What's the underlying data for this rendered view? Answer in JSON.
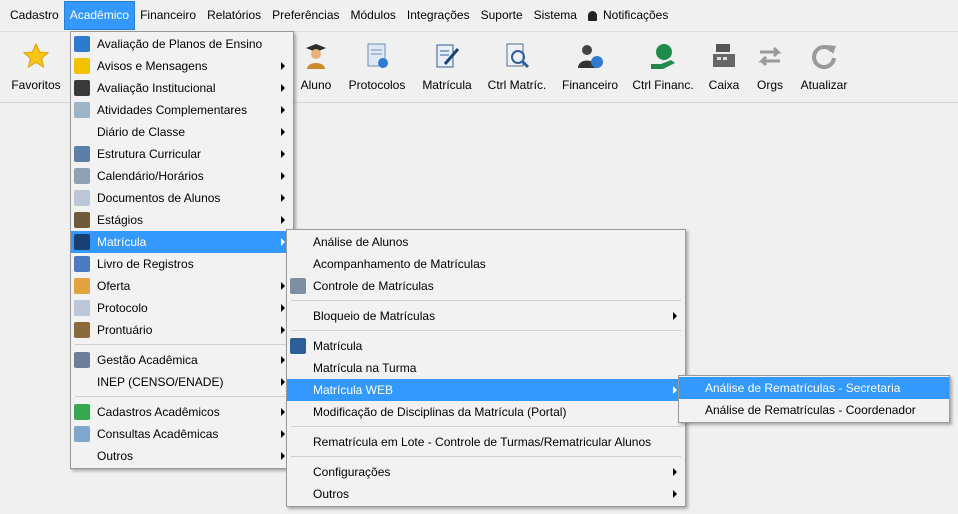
{
  "menubar": {
    "items": [
      "Cadastro",
      "Acadêmico",
      "Financeiro",
      "Relatórios",
      "Preferências",
      "Módulos",
      "Integrações",
      "Suporte",
      "Sistema"
    ],
    "notifications": "Notificações"
  },
  "toolbar": {
    "favoritos": "Favoritos",
    "aluno": "Aluno",
    "protocolos": "Protocolos",
    "matricula": "Matrícula",
    "ctrl_matric": "Ctrl Matríc.",
    "financeiro": "Financeiro",
    "ctrl_financ": "Ctrl Financ.",
    "caixa": "Caixa",
    "orgs": "Orgs",
    "atualizar": "Atualizar"
  },
  "academico_menu": {
    "items": [
      "Avaliação de Planos de Ensino",
      "Avisos e Mensagens",
      "Avaliação Institucional",
      "Atividades Complementares",
      "Diário de Classe",
      "Estrutura Curricular",
      "Calendário/Horários",
      "Documentos de Alunos",
      "Estágios",
      "Matrícula",
      "Livro de Registros",
      "Oferta",
      "Protocolo",
      "Prontuário",
      "Gestão Acadêmica",
      "INEP (CENSO/ENADE)",
      "Cadastros Acadêmicos",
      "Consultas Acadêmicas",
      "Outros"
    ]
  },
  "matricula_menu": {
    "items": [
      "Análise de Alunos",
      "Acompanhamento de Matrículas",
      "Controle de Matrículas",
      "Bloqueio de Matrículas",
      "Matrícula",
      "Matrícula na Turma",
      "Matrícula WEB",
      "Modificação de Disciplinas da Matrícula (Portal)",
      "Rematrícula em Lote - Controle de Turmas/Rematricular Alunos",
      "Configurações",
      "Outros"
    ]
  },
  "web_menu": {
    "items": [
      "Análise de Rematrículas - Secretaria",
      "Análise de Rematrículas - Coordenador"
    ]
  },
  "colors": {
    "highlight": "#3399ff",
    "menu_bg": "#f2f2f2",
    "window_bg": "#f0f0f0"
  }
}
